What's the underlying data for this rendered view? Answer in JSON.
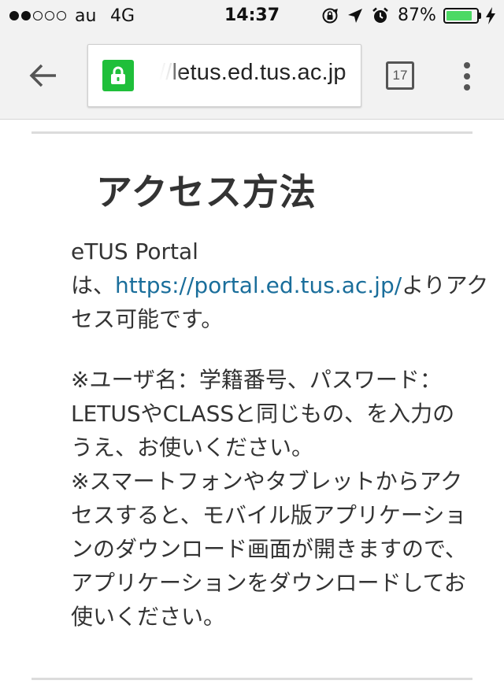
{
  "status_bar": {
    "signal_filled": 2,
    "signal_total": 5,
    "carrier": "au",
    "network": "4G",
    "time": "14:37",
    "battery_percent": "87%",
    "battery_level": 0.87,
    "icons": [
      "orientation-lock-icon",
      "location-arrow-icon",
      "alarm-icon",
      "charging-bolt-icon"
    ]
  },
  "browser": {
    "back_icon": "arrow-left-icon",
    "secure_icon": "lock-icon",
    "url_prefix": "//",
    "url_host": "letus.ed.tus.ac.jp",
    "tab_count": "17",
    "menu_icon": "more-vert-icon",
    "secure_color": "#1fbf3a"
  },
  "content": {
    "title": "アクセス方法",
    "para1": {
      "line1": "eTUS Portal",
      "line2_pre": "は、",
      "link": "https://portal.ed.tus.ac.jp/",
      "line2_post": "よりアク",
      "line3": "セス可能です。"
    },
    "para2": {
      "lines": [
        "※ユーザ名：学籍番号、パスワード：",
        "LETUSやCLASSと同じもの、を入力の",
        "うえ、お使いください。",
        "※スマートフォンやタブレットからアク",
        "セスすると、モバイル版アプリケーショ",
        "ンのダウンロード画面が開きますので、",
        "アプリケーションをダウンロードしてお",
        "使いください。"
      ]
    },
    "link_color": "#1a6e9b"
  }
}
